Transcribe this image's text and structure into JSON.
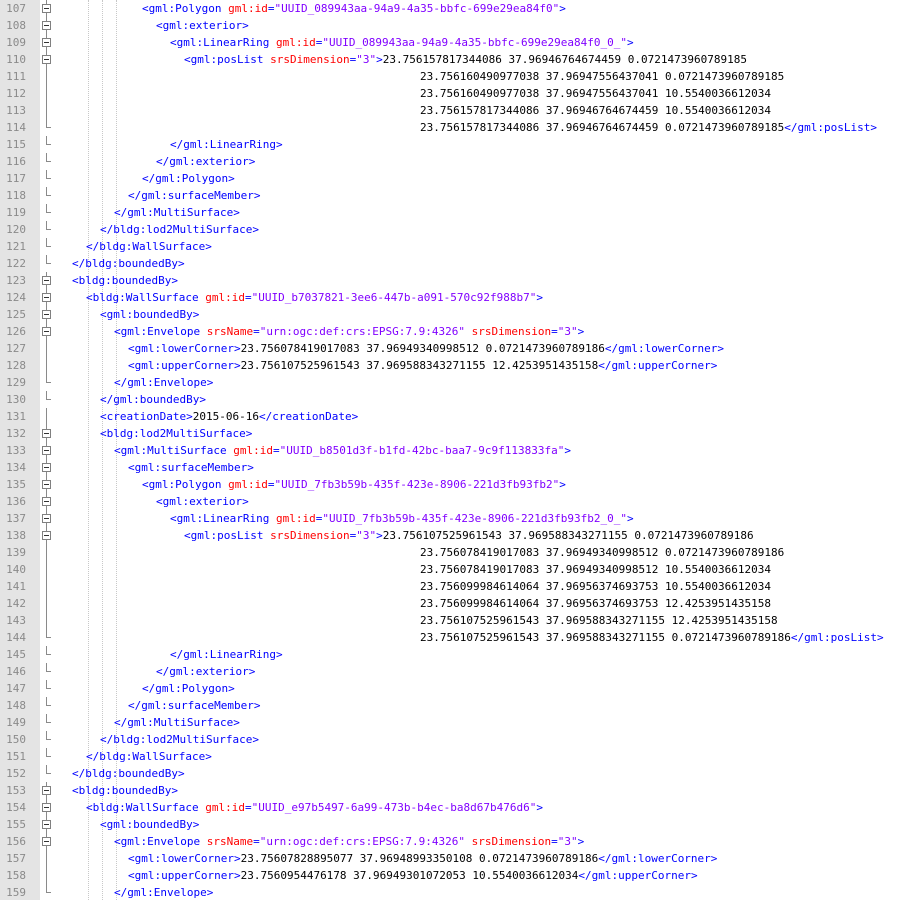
{
  "lines": [
    {
      "n": "107",
      "fold": "box",
      "indent": 6,
      "segs": [
        [
          "tag",
          "<gml:Polygon "
        ],
        [
          "attr",
          "gml:id"
        ],
        [
          "tag",
          "="
        ],
        [
          "val",
          "\"UUID_089943aa-94a9-4a35-bbfc-699e29ea84f0\""
        ],
        [
          "tag",
          ">"
        ]
      ]
    },
    {
      "n": "108",
      "fold": "box",
      "indent": 7,
      "segs": [
        [
          "tag",
          "<gml:exterior>"
        ]
      ]
    },
    {
      "n": "109",
      "fold": "box",
      "indent": 8,
      "segs": [
        [
          "tag",
          "<gml:LinearRing "
        ],
        [
          "attr",
          "gml:id"
        ],
        [
          "tag",
          "="
        ],
        [
          "val",
          "\"UUID_089943aa-94a9-4a35-bbfc-699e29ea84f0_0_\""
        ],
        [
          "tag",
          ">"
        ]
      ]
    },
    {
      "n": "110",
      "fold": "box",
      "indent": 9,
      "segs": [
        [
          "tag",
          "<gml:posList "
        ],
        [
          "attr",
          "srsDimension"
        ],
        [
          "tag",
          "="
        ],
        [
          "val",
          "\"3\""
        ],
        [
          "tag",
          ">"
        ],
        [
          "txt",
          "23.756157817344086 37.96946764674459 0.0721473960789185"
        ]
      ]
    },
    {
      "n": "111",
      "fold": "line",
      "indent": 0,
      "pad": 420,
      "segs": [
        [
          "txt",
          "23.756160490977038 37.96947556437041 0.0721473960789185"
        ]
      ]
    },
    {
      "n": "112",
      "fold": "line",
      "indent": 0,
      "pad": 420,
      "segs": [
        [
          "txt",
          "23.756160490977038 37.96947556437041 10.5540036612034"
        ]
      ]
    },
    {
      "n": "113",
      "fold": "line",
      "indent": 0,
      "pad": 420,
      "segs": [
        [
          "txt",
          "23.756157817344086 37.96946764674459 10.5540036612034"
        ]
      ]
    },
    {
      "n": "114",
      "fold": "end",
      "indent": 0,
      "pad": 420,
      "segs": [
        [
          "txt",
          "23.756157817344086 37.96946764674459 0.0721473960789185"
        ],
        [
          "tag",
          "</gml:posList>"
        ]
      ]
    },
    {
      "n": "115",
      "fold": "end",
      "indent": 8,
      "segs": [
        [
          "tag",
          "</gml:LinearRing>"
        ]
      ]
    },
    {
      "n": "116",
      "fold": "end",
      "indent": 7,
      "segs": [
        [
          "tag",
          "</gml:exterior>"
        ]
      ]
    },
    {
      "n": "117",
      "fold": "end",
      "indent": 6,
      "segs": [
        [
          "tag",
          "</gml:Polygon>"
        ]
      ]
    },
    {
      "n": "118",
      "fold": "end",
      "indent": 5,
      "segs": [
        [
          "tag",
          "</gml:surfaceMember>"
        ]
      ]
    },
    {
      "n": "119",
      "fold": "end",
      "indent": 4,
      "segs": [
        [
          "tag",
          "</gml:MultiSurface>"
        ]
      ]
    },
    {
      "n": "120",
      "fold": "end",
      "indent": 3,
      "segs": [
        [
          "tag",
          "</bldg:lod2MultiSurface>"
        ]
      ]
    },
    {
      "n": "121",
      "fold": "end",
      "indent": 2,
      "segs": [
        [
          "tag",
          "</bldg:WallSurface>"
        ]
      ]
    },
    {
      "n": "122",
      "fold": "end",
      "indent": 1,
      "segs": [
        [
          "tag",
          "</bldg:boundedBy>"
        ]
      ]
    },
    {
      "n": "123",
      "fold": "box",
      "indent": 1,
      "segs": [
        [
          "tag",
          "<bldg:boundedBy>"
        ]
      ]
    },
    {
      "n": "124",
      "fold": "box",
      "indent": 2,
      "segs": [
        [
          "tag",
          "<bldg:WallSurface "
        ],
        [
          "attr",
          "gml:id"
        ],
        [
          "tag",
          "="
        ],
        [
          "val",
          "\"UUID_b7037821-3ee6-447b-a091-570c92f988b7\""
        ],
        [
          "tag",
          ">"
        ]
      ]
    },
    {
      "n": "125",
      "fold": "box",
      "indent": 3,
      "segs": [
        [
          "tag",
          "<gml:boundedBy>"
        ]
      ]
    },
    {
      "n": "126",
      "fold": "box",
      "indent": 4,
      "segs": [
        [
          "tag",
          "<gml:Envelope "
        ],
        [
          "attr",
          "srsName"
        ],
        [
          "tag",
          "="
        ],
        [
          "val",
          "\"urn:ogc:def:crs:EPSG:7.9:4326\""
        ],
        [
          "tag",
          " "
        ],
        [
          "attr",
          "srsDimension"
        ],
        [
          "tag",
          "="
        ],
        [
          "val",
          "\"3\""
        ],
        [
          "tag",
          ">"
        ]
      ]
    },
    {
      "n": "127",
      "fold": "line",
      "indent": 5,
      "segs": [
        [
          "tag",
          "<gml:lowerCorner>"
        ],
        [
          "txt",
          "23.756078419017083 37.96949340998512 0.0721473960789186"
        ],
        [
          "tag",
          "</gml:lowerCorner>"
        ]
      ]
    },
    {
      "n": "128",
      "fold": "line",
      "indent": 5,
      "segs": [
        [
          "tag",
          "<gml:upperCorner>"
        ],
        [
          "txt",
          "23.756107525961543 37.969588343271155 12.4253951435158"
        ],
        [
          "tag",
          "</gml:upperCorner>"
        ]
      ]
    },
    {
      "n": "129",
      "fold": "end",
      "indent": 4,
      "segs": [
        [
          "tag",
          "</gml:Envelope>"
        ]
      ]
    },
    {
      "n": "130",
      "fold": "end",
      "indent": 3,
      "segs": [
        [
          "tag",
          "</gml:boundedBy>"
        ]
      ]
    },
    {
      "n": "131",
      "fold": "line",
      "indent": 3,
      "segs": [
        [
          "tag",
          "<creationDate>"
        ],
        [
          "txt",
          "2015-06-16"
        ],
        [
          "tag",
          "</creationDate>"
        ]
      ]
    },
    {
      "n": "132",
      "fold": "box",
      "indent": 3,
      "segs": [
        [
          "tag",
          "<bldg:lod2MultiSurface>"
        ]
      ]
    },
    {
      "n": "133",
      "fold": "box",
      "indent": 4,
      "segs": [
        [
          "tag",
          "<gml:MultiSurface "
        ],
        [
          "attr",
          "gml:id"
        ],
        [
          "tag",
          "="
        ],
        [
          "val",
          "\"UUID_b8501d3f-b1fd-42bc-baa7-9c9f113833fa\""
        ],
        [
          "tag",
          ">"
        ]
      ]
    },
    {
      "n": "134",
      "fold": "box",
      "indent": 5,
      "segs": [
        [
          "tag",
          "<gml:surfaceMember>"
        ]
      ]
    },
    {
      "n": "135",
      "fold": "box",
      "indent": 6,
      "segs": [
        [
          "tag",
          "<gml:Polygon "
        ],
        [
          "attr",
          "gml:id"
        ],
        [
          "tag",
          "="
        ],
        [
          "val",
          "\"UUID_7fb3b59b-435f-423e-8906-221d3fb93fb2\""
        ],
        [
          "tag",
          ">"
        ]
      ]
    },
    {
      "n": "136",
      "fold": "box",
      "indent": 7,
      "segs": [
        [
          "tag",
          "<gml:exterior>"
        ]
      ]
    },
    {
      "n": "137",
      "fold": "box",
      "indent": 8,
      "segs": [
        [
          "tag",
          "<gml:LinearRing "
        ],
        [
          "attr",
          "gml:id"
        ],
        [
          "tag",
          "="
        ],
        [
          "val",
          "\"UUID_7fb3b59b-435f-423e-8906-221d3fb93fb2_0_\""
        ],
        [
          "tag",
          ">"
        ]
      ]
    },
    {
      "n": "138",
      "fold": "box",
      "indent": 9,
      "segs": [
        [
          "tag",
          "<gml:posList "
        ],
        [
          "attr",
          "srsDimension"
        ],
        [
          "tag",
          "="
        ],
        [
          "val",
          "\"3\""
        ],
        [
          "tag",
          ">"
        ],
        [
          "txt",
          "23.756107525961543 37.969588343271155 0.0721473960789186"
        ]
      ]
    },
    {
      "n": "139",
      "fold": "line",
      "indent": 0,
      "pad": 420,
      "segs": [
        [
          "txt",
          "23.756078419017083 37.96949340998512 0.0721473960789186"
        ]
      ]
    },
    {
      "n": "140",
      "fold": "line",
      "indent": 0,
      "pad": 420,
      "segs": [
        [
          "txt",
          "23.756078419017083 37.96949340998512 10.5540036612034"
        ]
      ]
    },
    {
      "n": "141",
      "fold": "line",
      "indent": 0,
      "pad": 420,
      "segs": [
        [
          "txt",
          "23.756099984614064 37.96956374693753 10.5540036612034"
        ]
      ]
    },
    {
      "n": "142",
      "fold": "line",
      "indent": 0,
      "pad": 420,
      "segs": [
        [
          "txt",
          "23.756099984614064 37.96956374693753 12.4253951435158"
        ]
      ]
    },
    {
      "n": "143",
      "fold": "line",
      "indent": 0,
      "pad": 420,
      "segs": [
        [
          "txt",
          "23.756107525961543 37.969588343271155 12.4253951435158"
        ]
      ]
    },
    {
      "n": "144",
      "fold": "end",
      "indent": 0,
      "pad": 420,
      "segs": [
        [
          "txt",
          "23.756107525961543 37.969588343271155 0.0721473960789186"
        ],
        [
          "tag",
          "</gml:posList>"
        ]
      ]
    },
    {
      "n": "145",
      "fold": "end",
      "indent": 8,
      "segs": [
        [
          "tag",
          "</gml:LinearRing>"
        ]
      ]
    },
    {
      "n": "146",
      "fold": "end",
      "indent": 7,
      "segs": [
        [
          "tag",
          "</gml:exterior>"
        ]
      ]
    },
    {
      "n": "147",
      "fold": "end",
      "indent": 6,
      "segs": [
        [
          "tag",
          "</gml:Polygon>"
        ]
      ]
    },
    {
      "n": "148",
      "fold": "end",
      "indent": 5,
      "segs": [
        [
          "tag",
          "</gml:surfaceMember>"
        ]
      ]
    },
    {
      "n": "149",
      "fold": "end",
      "indent": 4,
      "segs": [
        [
          "tag",
          "</gml:MultiSurface>"
        ]
      ]
    },
    {
      "n": "150",
      "fold": "end",
      "indent": 3,
      "segs": [
        [
          "tag",
          "</bldg:lod2MultiSurface>"
        ]
      ]
    },
    {
      "n": "151",
      "fold": "end",
      "indent": 2,
      "segs": [
        [
          "tag",
          "</bldg:WallSurface>"
        ]
      ]
    },
    {
      "n": "152",
      "fold": "end",
      "indent": 1,
      "segs": [
        [
          "tag",
          "</bldg:boundedBy>"
        ]
      ]
    },
    {
      "n": "153",
      "fold": "box",
      "indent": 1,
      "segs": [
        [
          "tag",
          "<bldg:boundedBy>"
        ]
      ]
    },
    {
      "n": "154",
      "fold": "box",
      "indent": 2,
      "segs": [
        [
          "tag",
          "<bldg:WallSurface "
        ],
        [
          "attr",
          "gml:id"
        ],
        [
          "tag",
          "="
        ],
        [
          "val",
          "\"UUID_e97b5497-6a99-473b-b4ec-ba8d67b476d6\""
        ],
        [
          "tag",
          ">"
        ]
      ]
    },
    {
      "n": "155",
      "fold": "box",
      "indent": 3,
      "segs": [
        [
          "tag",
          "<gml:boundedBy>"
        ]
      ]
    },
    {
      "n": "156",
      "fold": "box",
      "indent": 4,
      "segs": [
        [
          "tag",
          "<gml:Envelope "
        ],
        [
          "attr",
          "srsName"
        ],
        [
          "tag",
          "="
        ],
        [
          "val",
          "\"urn:ogc:def:crs:EPSG:7.9:4326\""
        ],
        [
          "tag",
          " "
        ],
        [
          "attr",
          "srsDimension"
        ],
        [
          "tag",
          "="
        ],
        [
          "val",
          "\"3\""
        ],
        [
          "tag",
          ">"
        ]
      ]
    },
    {
      "n": "157",
      "fold": "line",
      "indent": 5,
      "segs": [
        [
          "tag",
          "<gml:lowerCorner>"
        ],
        [
          "txt",
          "23.75607828895077 37.96948993350108 0.0721473960789186"
        ],
        [
          "tag",
          "</gml:lowerCorner>"
        ]
      ]
    },
    {
      "n": "158",
      "fold": "line",
      "indent": 5,
      "segs": [
        [
          "tag",
          "<gml:upperCorner>"
        ],
        [
          "txt",
          "23.7560954476178 37.96949301072053 10.5540036612034"
        ],
        [
          "tag",
          "</gml:upperCorner>"
        ]
      ]
    },
    {
      "n": "159",
      "fold": "end",
      "indent": 4,
      "segs": [
        [
          "tag",
          "</gml:Envelope>"
        ]
      ]
    }
  ]
}
